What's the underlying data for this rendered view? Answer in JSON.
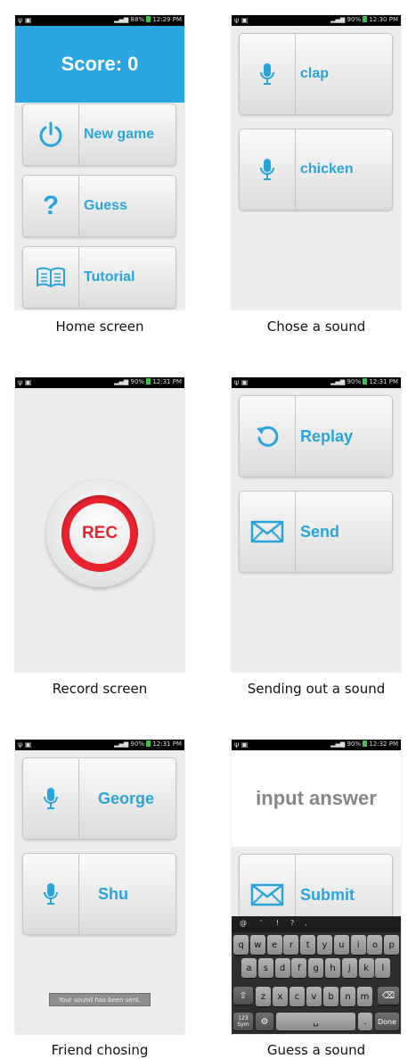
{
  "colors": {
    "accent": "#2aa7e2",
    "rec_red": "#e8222e",
    "tile_text": "#2aa5dc"
  },
  "screens": {
    "home": {
      "status_time": "12:29 PM",
      "status_battery": "88%",
      "score": "Score: 0",
      "buttons": [
        {
          "label": "New game",
          "icon": "power-icon"
        },
        {
          "label": "Guess",
          "icon": "question-icon"
        },
        {
          "label": "Tutorial",
          "icon": "book-icon"
        }
      ],
      "caption": "Home screen"
    },
    "chose": {
      "status_time": "12:30 PM",
      "status_battery": "90%",
      "buttons": [
        {
          "label": "clap",
          "icon": "mic-icon"
        },
        {
          "label": "chicken",
          "icon": "mic-icon"
        }
      ],
      "caption": "Chose a sound"
    },
    "record": {
      "status_time": "12:31 PM",
      "status_battery": "90%",
      "rec_label": "REC",
      "caption": "Record screen"
    },
    "sending": {
      "status_time": "12:31 PM",
      "status_battery": "90%",
      "buttons": [
        {
          "label": "Replay",
          "icon": "replay-icon"
        },
        {
          "label": "Send",
          "icon": "envelope-icon"
        }
      ],
      "caption": "Sending out a sound"
    },
    "friend": {
      "status_time": "12:31 PM",
      "status_battery": "90%",
      "buttons": [
        {
          "label": "George",
          "icon": "mic-icon"
        },
        {
          "label": "Shu",
          "icon": "mic-icon"
        }
      ],
      "toast": "Your sound has been sent.",
      "caption": "Friend chosing"
    },
    "guess": {
      "status_time": "12:32 PM",
      "status_battery": "90%",
      "answer_placeholder": "input answer",
      "submit_label": "Submit",
      "keyboard": {
        "top_row": [
          "@",
          "'",
          "!",
          "?",
          ","
        ],
        "row1": [
          "q",
          "w",
          "e",
          "r",
          "t",
          "y",
          "u",
          "i",
          "o",
          "p"
        ],
        "row2": [
          "a",
          "s",
          "d",
          "f",
          "g",
          "h",
          "j",
          "k",
          "l"
        ],
        "row3": [
          "z",
          "x",
          "c",
          "v",
          "b",
          "n",
          "m"
        ],
        "sym": "123 Sym",
        "period": ".",
        "done": "Done"
      },
      "caption": "Guess a sound"
    }
  }
}
